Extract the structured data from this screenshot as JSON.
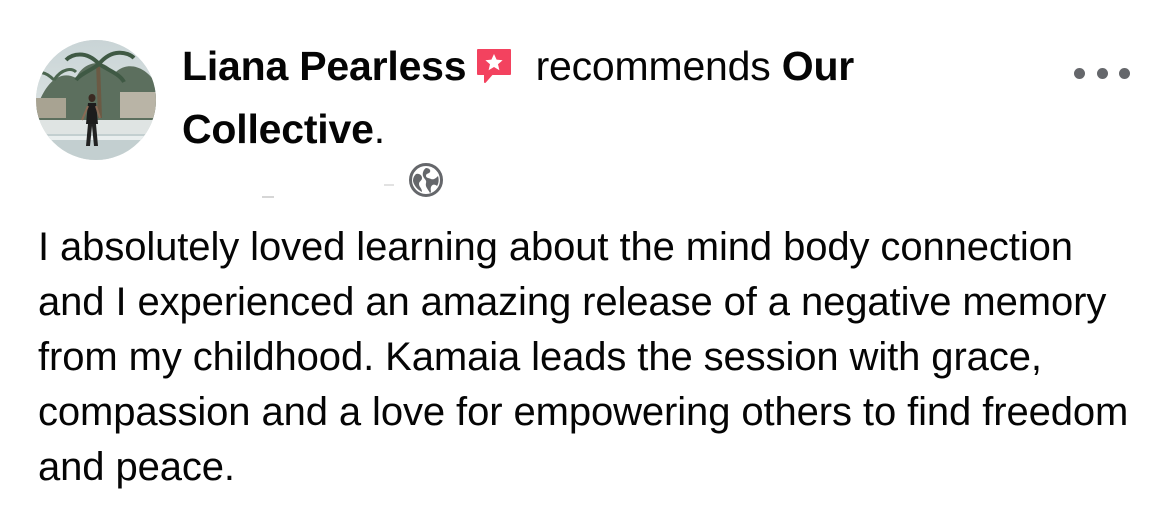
{
  "post": {
    "author": "Liana Pearless",
    "recommends_text": " recommends ",
    "page_name": "Our Collective",
    "period": ".",
    "audience_icon": "globe-icon",
    "more_icon": "more-options-icon",
    "badge_icon": "recommendation-star-icon",
    "body": "I absolutely loved learning about the mind body connection and I experienced an amazing release of a negative memory from my childhood. Kamaia leads the session with grace, compassion and a love for empowering others to find freedom and peace."
  },
  "colors": {
    "text": "#050505",
    "secondary": "#65676b",
    "badge": "#f3425f"
  }
}
